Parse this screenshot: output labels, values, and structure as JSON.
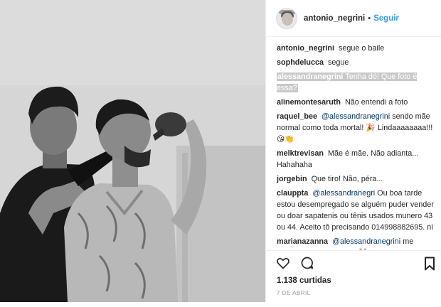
{
  "header": {
    "username": "antonio_negrini",
    "separator": "•",
    "follow_label": "Seguir"
  },
  "comments": [
    {
      "user": "antonio_negrini",
      "text": "segue o baile"
    },
    {
      "user": "sophdelucca",
      "text": "segue"
    },
    {
      "user": "alessandranegrini",
      "text": "Tenha dó! Que foto é essa?",
      "highlighted": true
    },
    {
      "user": "alinemontesaruth",
      "text": "Não entendi a foto"
    },
    {
      "user": "raquel_bee",
      "mention": "@alessandranegrini",
      "text": "sendo mãe normal como toda mortal! 🎉 Lindaaaaaaaa!!! 😘👏"
    },
    {
      "user": "melktrevisan",
      "text": "Mãe é mãe. Não adianta... Hahahaha"
    },
    {
      "user": "jorgebin",
      "text": "Que tiro! Não, péra..."
    },
    {
      "user": "clauppta",
      "mention": "@alessandranegri",
      "text": "Ou boa tarde estou desempregado se alguém puder vender ou doar sapatenis ou tênis usados munero 43 ou 44. Aceito tô precisando 014998882695. ni"
    },
    {
      "user": "marianazanna",
      "mention": "@alessandranegrini",
      "text": "me representa! Mãe é mãe 🖤"
    }
  ],
  "actions": {
    "like_icon": "heart-outline-icon",
    "comment_icon": "speech-bubble-icon",
    "save_icon": "bookmark-icon",
    "likes_text": "1.138 curtidas",
    "date_text": "7 DE ABRIL"
  },
  "colors": {
    "link_blue": "#3897f0",
    "mention_blue": "#003569",
    "border": "#efefef",
    "highlight": "#c9c9c9"
  }
}
